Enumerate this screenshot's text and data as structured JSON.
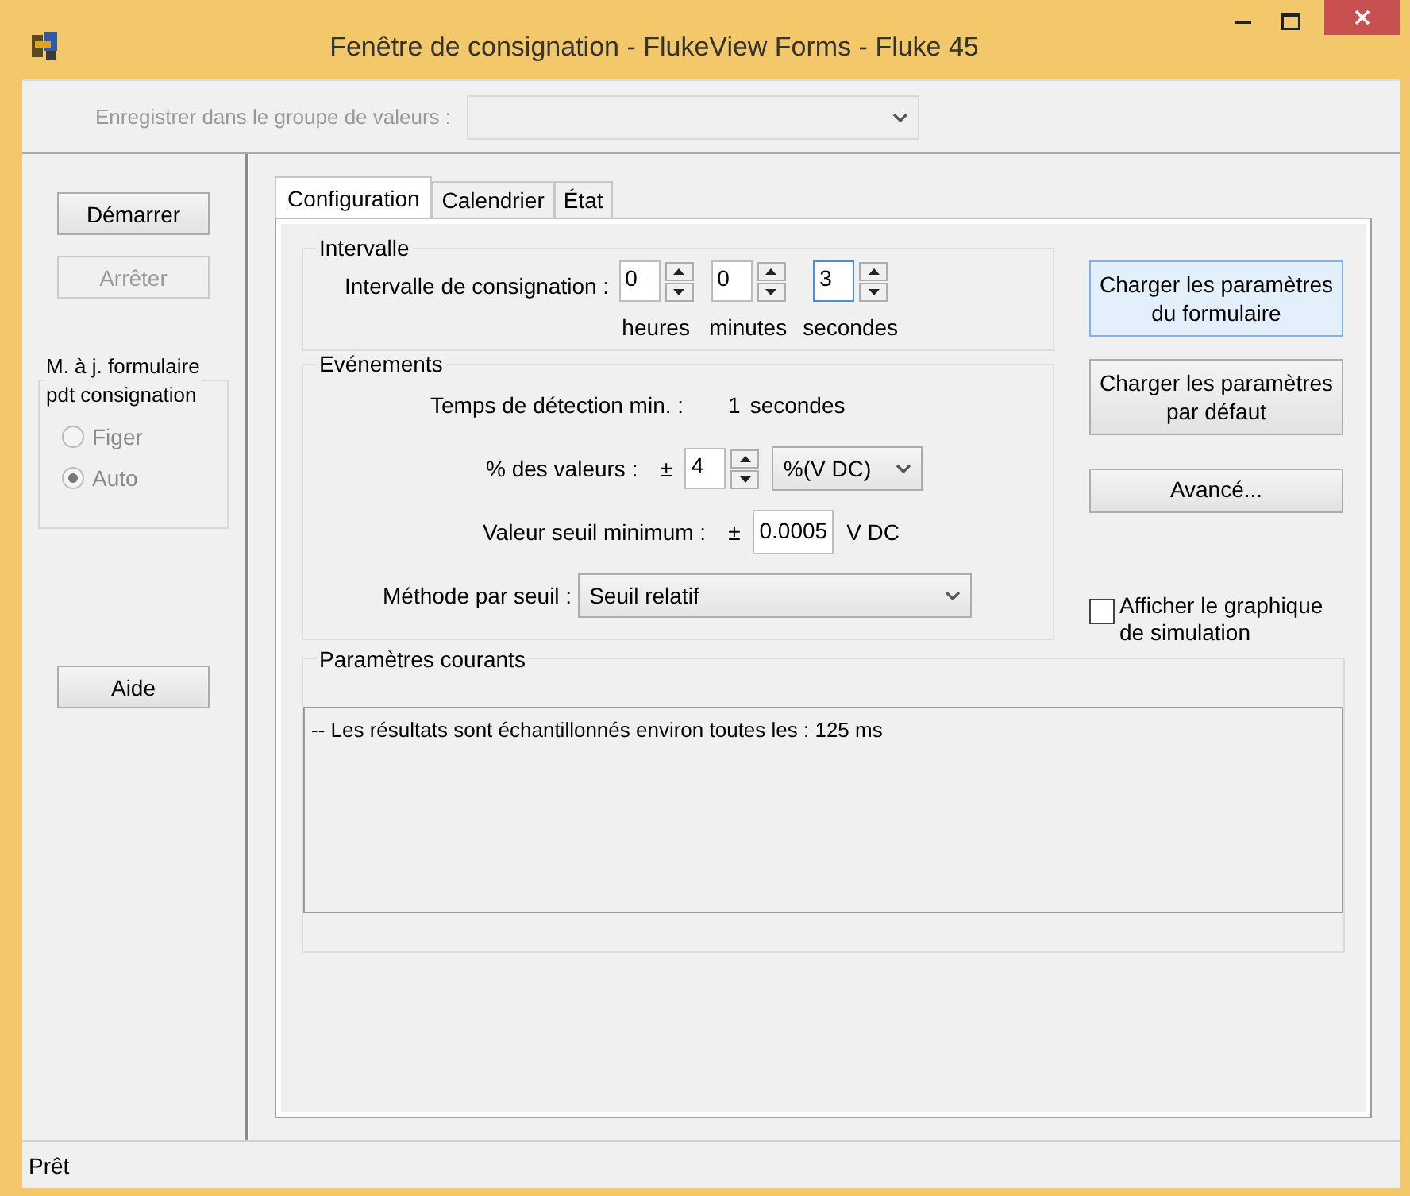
{
  "window": {
    "title": "Fenêtre de consignation - FlukeView Forms - Fluke 45"
  },
  "value_group": {
    "label": "Enregistrer dans le groupe de valeurs :",
    "disabled": true
  },
  "sidebar": {
    "buttons": [
      {
        "label": "Démarrer",
        "disabled": false
      },
      {
        "label": "Arrêter",
        "disabled": true
      }
    ],
    "update_group": {
      "title": "M. à j. formulaire\npdt consignation",
      "radios": [
        {
          "label": "Figer",
          "selected": false,
          "disabled": true
        },
        {
          "label": "Auto",
          "selected": true,
          "disabled": true
        }
      ]
    },
    "help_button": {
      "label": "Aide"
    }
  },
  "tabs": [
    {
      "label": "Configuration",
      "selected": true
    },
    {
      "label": "Calendrier",
      "selected": false
    },
    {
      "label": "État",
      "selected": false
    }
  ],
  "interval": {
    "title": "Intervalle",
    "label": "Intervalle de consignation :",
    "spinners": [
      {
        "value": "0",
        "unit": "heures",
        "focused": false
      },
      {
        "value": "0",
        "unit": "minutes",
        "focused": false
      },
      {
        "value": "3",
        "unit": "secondes",
        "focused": true
      }
    ]
  },
  "events": {
    "title": "Evénements",
    "detection": {
      "label": "Temps de détection min. :",
      "value": "1",
      "unit": "secondes"
    },
    "percent": {
      "label": "% des valeurs :",
      "sign": "±",
      "value": "4",
      "unit": "%(V DC)"
    },
    "threshold": {
      "label": "Valeur seuil minimum :",
      "sign": "±",
      "value": "0.0005",
      "unit": "V DC"
    },
    "method": {
      "label": "Méthode par seuil :",
      "value": "Seuil relatif"
    }
  },
  "side_buttons": [
    {
      "label": "Charger les paramètres\ndu formulaire",
      "focused": true
    },
    {
      "label": "Charger les paramètres\npar défaut",
      "focused": false
    },
    {
      "label": "Avancé...",
      "focused": false
    }
  ],
  "simulation_checkbox": {
    "label": "Afficher le graphique\nde simulation",
    "checked": false
  },
  "current_settings": {
    "title": "Paramètres courants",
    "lines": [
      "-- Les résultats sont échantillonnés environ toutes les : 125 ms"
    ]
  },
  "status_bar": {
    "text": "Prêt"
  }
}
